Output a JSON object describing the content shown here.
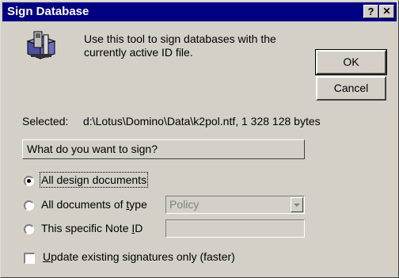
{
  "window": {
    "title": "Sign Database",
    "help_button": "?",
    "close_button": "✕"
  },
  "intro": {
    "icon": "sign-database-tool-icon",
    "line1": "Use this tool to sign databases with the",
    "line2": "currently active ID file."
  },
  "buttons": {
    "ok": "OK",
    "cancel": "Cancel"
  },
  "selected": {
    "label": "Selected:",
    "value": "d:\\Lotus\\Domino\\Data\\k2pol.ntf, 1 328 128 bytes"
  },
  "group": {
    "title": "What do you want to sign?"
  },
  "options": {
    "all_design": {
      "label": "All design documents",
      "selected": true
    },
    "all_type": {
      "label_pre": "All documents of ",
      "label_accel": "t",
      "label_post": "ype",
      "selected": false,
      "dropdown_value": "Policy"
    },
    "specific": {
      "label_pre": "This specific Note ",
      "label_accel": "I",
      "label_post": "D",
      "selected": false,
      "input_value": ""
    }
  },
  "checkbox": {
    "label_accel": "U",
    "label_rest": "pdate existing signatures only (faster)",
    "checked": false
  }
}
